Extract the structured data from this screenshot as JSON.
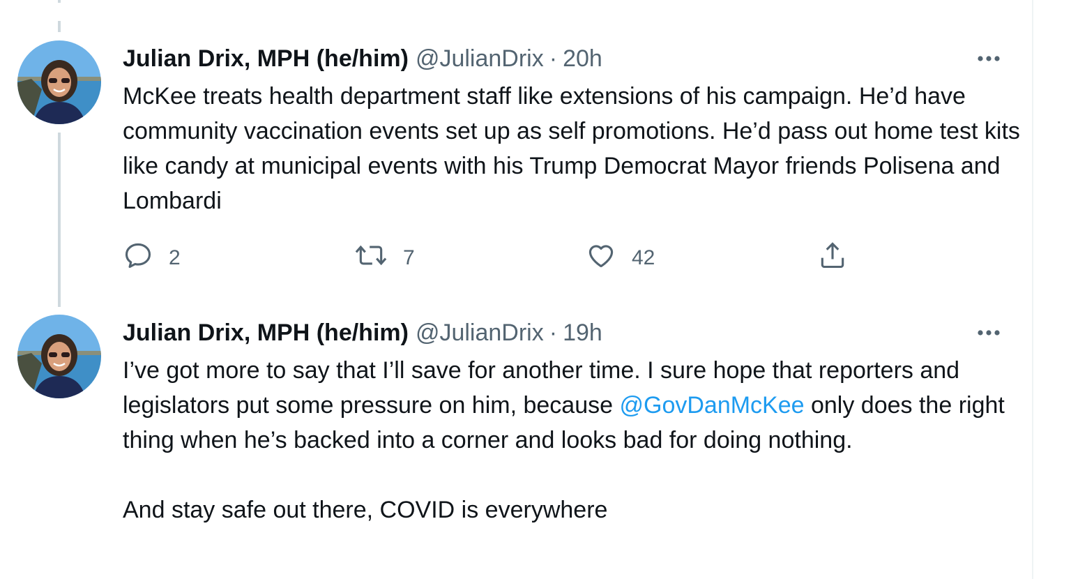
{
  "tweets": [
    {
      "name": "Julian Drix, MPH (he/him)",
      "handle": "@JulianDrix",
      "separator": "·",
      "time": "20h",
      "text": "McKee treats health department staff like extensions of his campaign. He’d have community vaccination events set up as self promotions. He’d pass out home test kits like candy at municipal events with his Trump Democrat Mayor friends Polisena and Lombardi",
      "reply_count": "2",
      "retweet_count": "7",
      "like_count": "42"
    },
    {
      "name": "Julian Drix, MPH (he/him)",
      "handle": "@JulianDrix",
      "separator": "·",
      "time": "19h",
      "text_before": "I’ve got more to say that I’ll save for another time. I sure hope that reporters and legislators put some pressure on him, because ",
      "mention": "@GovDanMcKee",
      "text_after": " only does the right thing when he’s backed into a corner and looks bad for doing nothing.\n\nAnd stay safe out there, COVID is everywhere"
    }
  ],
  "icons": {
    "more": "more-horizontal-icon",
    "reply": "reply-icon",
    "retweet": "retweet-icon",
    "like": "like-icon",
    "share": "share-icon"
  },
  "colors": {
    "text": "#0f1419",
    "secondary": "#536471",
    "link": "#1d9bf0",
    "thread_line": "#cfd9de"
  }
}
